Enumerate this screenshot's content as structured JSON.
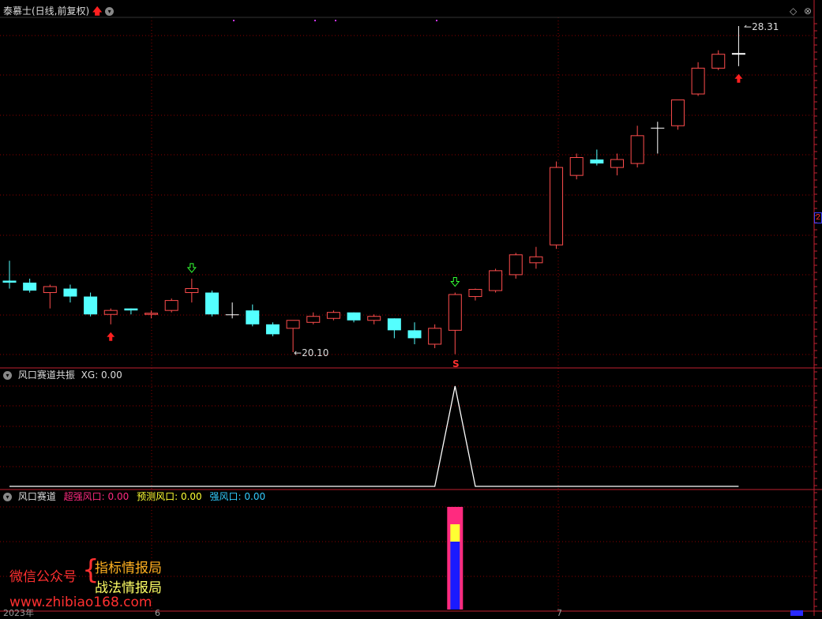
{
  "header": {
    "title": "泰慕士(日线,前复权)",
    "title_icons": [
      "red-up-arrow-icon",
      "dropdown-icon"
    ],
    "controls": [
      "diamond-icon",
      "close-circle-icon"
    ]
  },
  "main_chart": {
    "type": "candlestick",
    "price_max_label": "28.31",
    "price_min_label": "20.10",
    "right_axis_marker": "2",
    "signal_s_label": "S",
    "colors": {
      "up": "#ff4d4d",
      "down": "#54ffff",
      "doji": "#ffffff",
      "grid": "#8b0000",
      "separator": "#c02030"
    }
  },
  "indicator1": {
    "name": "风口赛道共振",
    "values_text": "XG: 0.00",
    "series": [
      {
        "name": "XG",
        "color": "#ffffff"
      }
    ]
  },
  "indicator2": {
    "name": "风口赛道",
    "items": [
      {
        "label": "超强风口:",
        "value": "0.00",
        "color": "#ff2a7f"
      },
      {
        "label": "预测风口:",
        "value": "0.00",
        "color": "#ffff33"
      },
      {
        "label": "强风口:",
        "value": "0.00",
        "color": "#33ccff"
      }
    ],
    "bar_colors": [
      "#ff2a7f",
      "#ffff33",
      "#1a1aff"
    ]
  },
  "watermark": {
    "wechat_label": "微信公众号",
    "brace": "{",
    "line1": "指标情报局",
    "line2": "战法情报局",
    "url": "www.zhibiao168.com"
  },
  "bottom_axis": {
    "year_label": "2023年",
    "month_label_1": "6",
    "month_label_2": "7"
  },
  "chart_data": {
    "type": "candlestick",
    "ohlc": [
      {
        "o": 21.9,
        "h": 22.4,
        "l": 21.7,
        "c": 21.85
      },
      {
        "o": 21.85,
        "h": 21.95,
        "l": 21.6,
        "c": 21.65
      },
      {
        "o": 21.6,
        "h": 21.8,
        "l": 21.2,
        "c": 21.75
      },
      {
        "o": 21.7,
        "h": 21.8,
        "l": 21.35,
        "c": 21.5
      },
      {
        "o": 21.5,
        "h": 21.6,
        "l": 21.0,
        "c": 21.05
      },
      {
        "o": 21.05,
        "h": 21.2,
        "l": 20.8,
        "c": 21.15
      },
      {
        "o": 21.2,
        "h": 21.2,
        "l": 21.05,
        "c": 21.15
      },
      {
        "o": 21.05,
        "h": 21.15,
        "l": 20.95,
        "c": 21.08
      },
      {
        "o": 21.15,
        "h": 21.45,
        "l": 21.1,
        "c": 21.4
      },
      {
        "o": 21.6,
        "h": 21.95,
        "l": 21.35,
        "c": 21.7
      },
      {
        "o": 21.6,
        "h": 21.65,
        "l": 21.0,
        "c": 21.05
      },
      {
        "o": 21.05,
        "h": 21.35,
        "l": 20.95,
        "c": 21.05
      },
      {
        "o": 21.15,
        "h": 21.3,
        "l": 20.75,
        "c": 20.8
      },
      {
        "o": 20.8,
        "h": 20.85,
        "l": 20.5,
        "c": 20.55
      },
      {
        "o": 20.7,
        "h": 20.9,
        "l": 20.1,
        "c": 20.9
      },
      {
        "o": 20.85,
        "h": 21.1,
        "l": 20.8,
        "c": 21.0
      },
      {
        "o": 20.95,
        "h": 21.15,
        "l": 20.9,
        "c": 21.1
      },
      {
        "o": 21.1,
        "h": 21.1,
        "l": 20.85,
        "c": 20.9
      },
      {
        "o": 20.9,
        "h": 21.05,
        "l": 20.8,
        "c": 21.0
      },
      {
        "o": 20.95,
        "h": 20.95,
        "l": 20.45,
        "c": 20.65
      },
      {
        "o": 20.65,
        "h": 20.85,
        "l": 20.3,
        "c": 20.45
      },
      {
        "o": 20.3,
        "h": 20.8,
        "l": 20.2,
        "c": 20.7
      },
      {
        "o": 20.65,
        "h": 21.6,
        "l": 20.05,
        "c": 21.55
      },
      {
        "o": 21.5,
        "h": 21.7,
        "l": 21.4,
        "c": 21.68
      },
      {
        "o": 21.65,
        "h": 22.2,
        "l": 21.6,
        "c": 22.15
      },
      {
        "o": 22.05,
        "h": 22.6,
        "l": 21.95,
        "c": 22.55
      },
      {
        "o": 22.35,
        "h": 22.75,
        "l": 22.2,
        "c": 22.5
      },
      {
        "o": 22.8,
        "h": 24.9,
        "l": 22.7,
        "c": 24.75
      },
      {
        "o": 24.55,
        "h": 25.1,
        "l": 24.45,
        "c": 25.0
      },
      {
        "o": 24.95,
        "h": 25.2,
        "l": 24.8,
        "c": 24.85
      },
      {
        "o": 24.75,
        "h": 25.1,
        "l": 24.55,
        "c": 24.95
      },
      {
        "o": 24.85,
        "h": 25.8,
        "l": 24.75,
        "c": 25.55
      },
      {
        "o": 25.75,
        "h": 25.9,
        "l": 25.1,
        "c": 25.75
      },
      {
        "o": 25.8,
        "h": 26.45,
        "l": 25.7,
        "c": 26.45
      },
      {
        "o": 26.6,
        "h": 27.4,
        "l": 26.55,
        "c": 27.25
      },
      {
        "o": 27.25,
        "h": 27.7,
        "l": 27.2,
        "c": 27.6
      },
      {
        "o": 27.6,
        "h": 28.31,
        "l": 27.3,
        "c": 27.62
      }
    ],
    "price_high": 28.31,
    "price_low": 20.1,
    "xg": [
      0,
      0,
      0,
      0,
      0,
      0,
      0,
      0,
      0,
      0,
      0,
      0,
      0,
      0,
      0,
      0,
      0,
      0,
      0,
      0,
      0,
      0,
      1,
      0,
      0,
      0,
      0,
      0,
      0,
      0,
      0,
      0,
      0,
      0,
      0,
      0,
      0
    ],
    "feng_kou": [
      0,
      0,
      0,
      0,
      0,
      0,
      0,
      0,
      0,
      0,
      0,
      0,
      0,
      0,
      0,
      0,
      0,
      0,
      0,
      0,
      0,
      0,
      1,
      0,
      0,
      0,
      0,
      0,
      0,
      0,
      0,
      0,
      0,
      0,
      0,
      0,
      0
    ],
    "up_arrow_signals": [
      5,
      36
    ],
    "down_arrow_signals": [
      9,
      22
    ]
  }
}
